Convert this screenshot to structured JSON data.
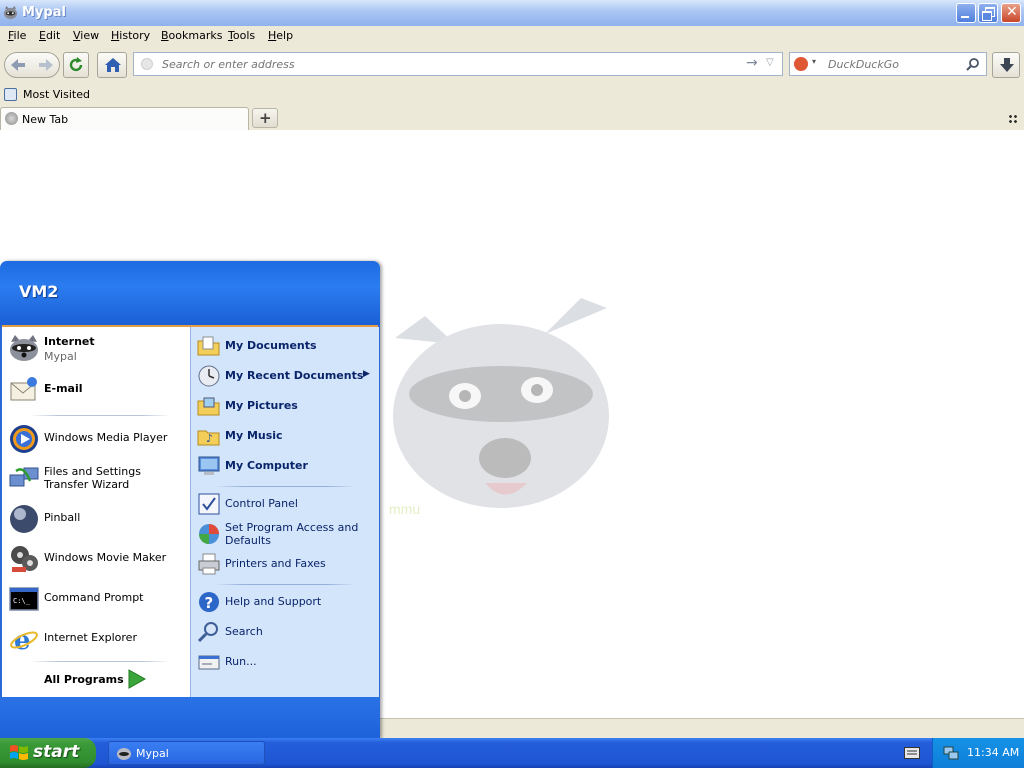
{
  "window": {
    "title": "Mypal"
  },
  "menubar": {
    "items": [
      "File",
      "Edit",
      "View",
      "History",
      "Bookmarks",
      "Tools",
      "Help"
    ]
  },
  "navbar": {
    "url_placeholder": "Search or enter address",
    "search_placeholder": "DuckDuckGo"
  },
  "bookmarks": {
    "items": [
      {
        "label": "Most Visited",
        "icon": "most-visited-icon"
      }
    ]
  },
  "tabs": [
    {
      "label": "New Tab",
      "icon": "globe-icon"
    }
  ],
  "start_menu": {
    "user": "VM2",
    "pinned": [
      {
        "title": "Internet",
        "subtitle": "Mypal",
        "icon": "raccoon-browser-icon"
      },
      {
        "title": "E-mail",
        "icon": "email-icon"
      }
    ],
    "recent": [
      {
        "label": "Windows Media Player",
        "icon": "media-player-icon"
      },
      {
        "label": "Files and Settings Transfer Wizard",
        "icon": "transfer-wizard-icon"
      },
      {
        "label": "Pinball",
        "icon": "pinball-icon"
      },
      {
        "label": "Windows Movie Maker",
        "icon": "movie-maker-icon"
      },
      {
        "label": "Command Prompt",
        "icon": "command-prompt-icon"
      },
      {
        "label": "Internet Explorer",
        "icon": "internet-explorer-icon"
      }
    ],
    "all_programs": "All Programs",
    "places": [
      {
        "label": "My Documents",
        "icon": "my-documents-icon"
      },
      {
        "label": "My Recent Documents",
        "icon": "my-recent-documents-icon"
      },
      {
        "label": "My Pictures",
        "icon": "my-pictures-icon"
      },
      {
        "label": "My Music",
        "icon": "my-music-icon"
      },
      {
        "label": "My Computer",
        "icon": "my-computer-icon"
      }
    ],
    "settings": [
      {
        "label": "Control Panel",
        "icon": "control-panel-icon"
      },
      {
        "label": "Set Program Access and Defaults",
        "icon": "program-access-icon"
      },
      {
        "label": "Printers and Faxes",
        "icon": "printer-icon"
      }
    ],
    "help": [
      {
        "label": "Help and Support",
        "icon": "help-icon"
      },
      {
        "label": "Search",
        "icon": "search-icon"
      },
      {
        "label": "Run...",
        "icon": "run-icon"
      }
    ]
  },
  "taskbar": {
    "start_label": "start",
    "tasks": [
      {
        "label": "Mypal",
        "icon": "raccoon-browser-icon"
      }
    ],
    "clock": "11:34 AM"
  },
  "colors": {
    "taskbar": "#245edb",
    "start_button": "#3b9a38",
    "menu_header": "#1e6be2",
    "places_bg": "#d3e5fa"
  }
}
